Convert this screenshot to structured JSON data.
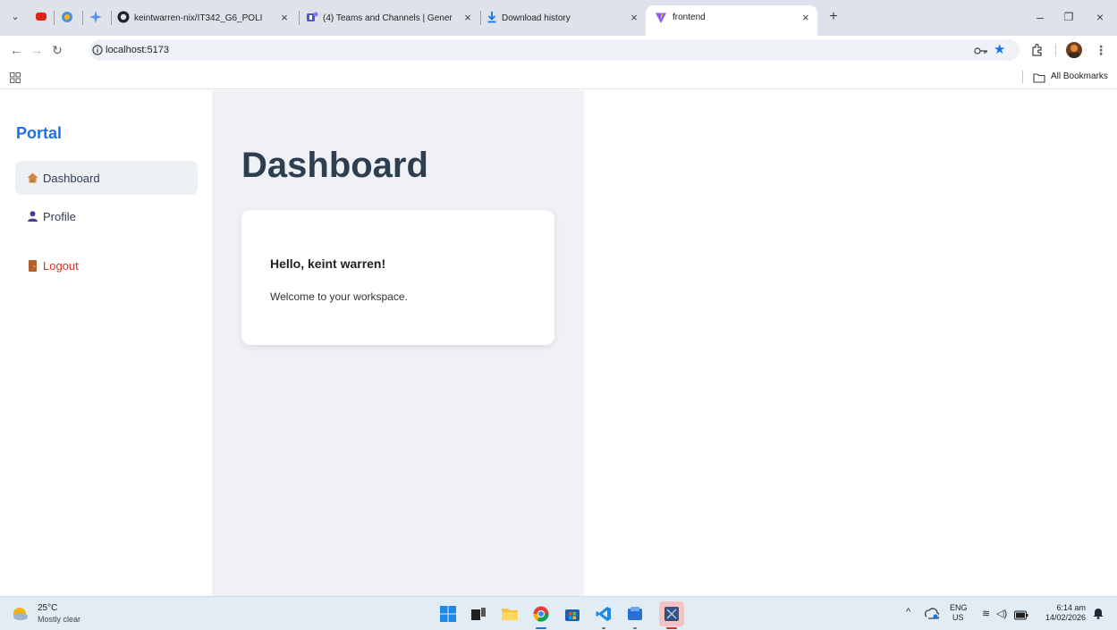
{
  "browser": {
    "tabs": [
      {
        "title": "keintwarren-nix/IT342_G6_POLI"
      },
      {
        "title": "(4) Teams and Channels | Gener"
      },
      {
        "title": "Download history"
      },
      {
        "title": "frontend",
        "active": true
      }
    ],
    "new_tab_label": "+",
    "url": "localhost:5173",
    "bookmarks_label": "All Bookmarks"
  },
  "app": {
    "brand": "Portal",
    "nav": [
      {
        "label": "Dashboard",
        "icon": "house-icon",
        "active": true
      },
      {
        "label": "Profile",
        "icon": "person-icon"
      },
      {
        "label": "Logout",
        "icon": "door-icon",
        "color": "#d93025"
      }
    ],
    "page_title": "Dashboard",
    "card": {
      "greeting": "Hello, keint warren!",
      "message": "Welcome to your workspace."
    }
  },
  "taskbar": {
    "weather_temp": "25°C",
    "weather_condition": "Mostly clear",
    "lang_primary": "ENG",
    "lang_region": "US",
    "time": "6:14 am",
    "date": "14/02/2026"
  },
  "colors": {
    "accent": "#1a73e8",
    "logout": "#d93025",
    "heading": "#2c3e50",
    "main_bg": "#eff1f5"
  }
}
